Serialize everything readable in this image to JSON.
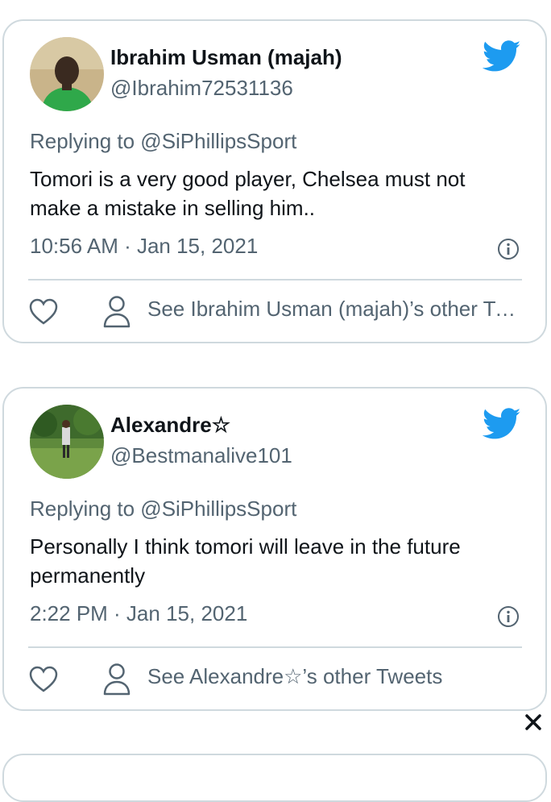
{
  "tweets": [
    {
      "name": "Ibrahim Usman (majah)",
      "handle": "@Ibrahim72531136",
      "replying_to": "Replying to @SiPhillipsSport",
      "text": "Tomori is a very good player, Chelsea must not make a mistake in selling him..",
      "timestamp": "10:56 AM · Jan 15, 2021",
      "see_other": "See Ibrahim Usman (majah)’s other Tweets"
    },
    {
      "name": "Alexandre☆",
      "handle": "@Bestmanalive101",
      "replying_to": "Replying to @SiPhillipsSport",
      "text": "Personally I think tomori will leave in the future permanently",
      "timestamp": "2:22 PM · Jan 15, 2021",
      "see_other": "See Alexandre☆’s other Tweets"
    }
  ],
  "icons": {
    "brand": "twitter-bird-icon",
    "info": "info-icon",
    "like": "heart-icon",
    "profile": "person-icon",
    "dismiss": "close-icon"
  },
  "colors": {
    "twitter_blue": "#1d9bf0",
    "text_primary": "#0f1419",
    "text_secondary": "#536471",
    "border": "#cfd9de"
  }
}
